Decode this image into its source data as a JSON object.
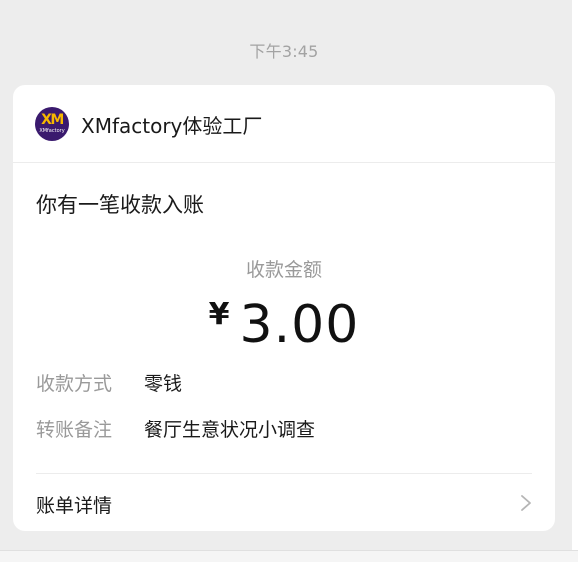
{
  "timestamp": "下午3:45",
  "sender": {
    "name": "XMfactory体验工厂",
    "avatar_text": "XM",
    "avatar_subtext": "XMfactory"
  },
  "notice": {
    "title": "你有一笔收款入账"
  },
  "payment": {
    "amount_label": "收款金额",
    "currency_symbol": "¥",
    "amount": "3.00"
  },
  "details": [
    {
      "label": "收款方式",
      "value": "零钱"
    },
    {
      "label": "转账备注",
      "value": "餐厅生意状况小调查"
    }
  ],
  "footer": {
    "details_link": "账单详情",
    "chevron_icon": "chevron-right-icon"
  },
  "colors": {
    "background": "#ededed",
    "card": "#ffffff",
    "avatar_bg": "#3a1a6e",
    "avatar_accent": "#f5b800",
    "muted_text": "#9a9a9a",
    "primary_text": "#1a1a1a"
  }
}
